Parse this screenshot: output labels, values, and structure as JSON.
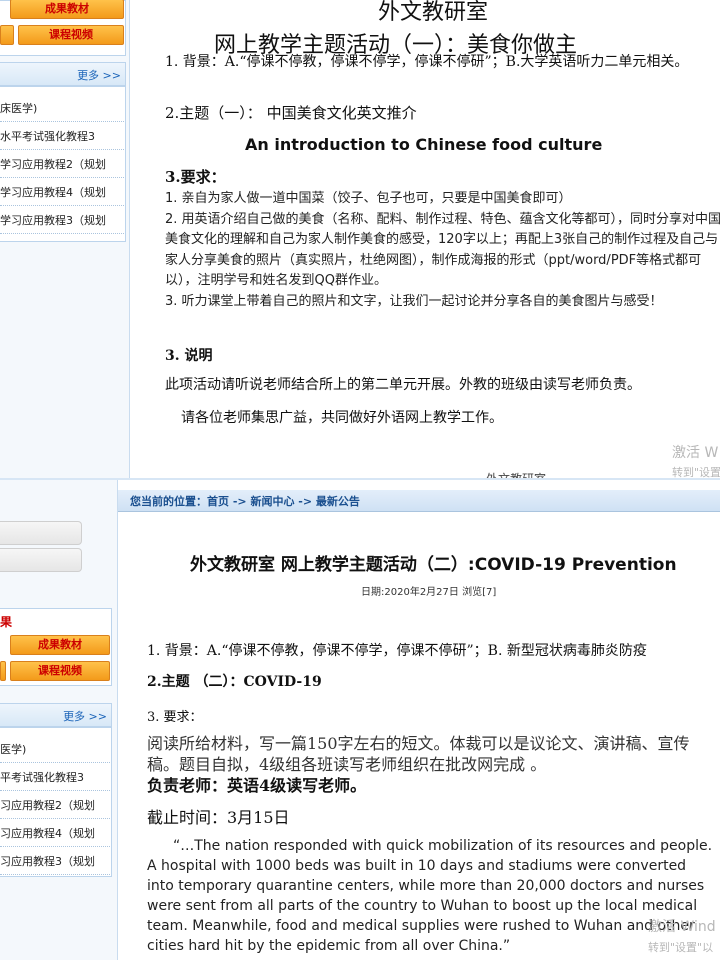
{
  "top": {
    "sidebar": {
      "buttons": [
        {
          "label": "成果教材"
        },
        {
          "label": "课程视频"
        }
      ],
      "more_label": "更多 >>",
      "items": [
        {
          "label": "床医学)"
        },
        {
          "label": "水平考试强化教程3"
        },
        {
          "label": "学习应用教程2（规划"
        },
        {
          "label": "学习应用教程4（规划"
        },
        {
          "label": "学习应用教程3（规划"
        }
      ]
    },
    "content": {
      "department": "外文教研室",
      "title": "网上教学主题活动（一）：美食你做主",
      "background": "1. 背景：A.“停课不停教，停课不停学，停课不停研”；B.大学英语听力二单元相关。",
      "theme": "2.主题（一）：  中国美食文化英文推介",
      "english_title": "An introduction to Chinese food culture",
      "requirements_heading": "3.要求：",
      "requirements": [
        "1. 亲自为家人做一道中国菜（饺子、包子也可，只要是中国美食即可）",
        "2. 用英语介绍自己做的美食（名称、配料、制作过程、特色、蕴含文化等都可），同时分享对中国美食文化的理解和自己为家人制作美食的感受，120字以上；再配上3张自己的制作过程及自己与家人分享美食的照片（真实照片，杜绝网图），制作成海报的形式（ppt/word/PDF等格式都可以），注明学号和姓名发到QQ群作业。",
        "3. 听力课堂上带着自己的照片和文字，让我们一起讨论并分享各自的美食图片与感受！"
      ],
      "note_heading": "3. 说明",
      "note_1": "此项活动请听说老师结合所上的第二单元开展。外教的班级由读写老师负责。",
      "note_2": "请各位老师集思广益，共同做好外语网上教学工作。",
      "watermark_1": "激活 W",
      "watermark_2": "转到\"设置",
      "signature": "外文教研室"
    }
  },
  "bottom": {
    "sidebar": {
      "section_label": "果",
      "buttons": [
        {
          "label": "成果教材"
        },
        {
          "label": "课程视频"
        }
      ],
      "more_label": "更多 >>",
      "items": [
        {
          "label": "医学)"
        },
        {
          "label": "平考试强化教程3"
        },
        {
          "label": "习应用教程2（规划"
        },
        {
          "label": "习应用教程4（规划"
        },
        {
          "label": "习应用教程3（规划"
        }
      ]
    },
    "breadcrumb": "您当前的位置：首页 -> 新闻中心 -> 最新公告",
    "content": {
      "title": "外文教研室 网上教学主题活动（二）:COVID-19 Prevention",
      "date_line": "日期:2020年2月27日 浏览[7]",
      "background": "1. 背景：A.“停课不停教，停课不停学，停课不停研”；B. 新型冠状病毒肺炎防疫",
      "theme": "2.主题 （二）：COVID-19",
      "requirements_heading": "3. 要求：",
      "requirements": "阅读所给材料，写一篇150字左右的短文。体裁可以是议论文、演讲稿、宣传稿。题目自拟，4级组各班读写老师组织在批改网完成    。",
      "teacher": "负责老师：英语4级读写老师。",
      "deadline": "截止时间：3月15日",
      "quote": "“…The nation responded with quick mobilization of its resources and people. A hospital with 1000 beds was built in 10 days and stadiums were converted into temporary quarantine centers, while more than 20,000 doctors and nurses were sent from all parts of the country to Wuhan to boost up the local medical team. Meanwhile, food and medical supplies were rushed to Wuhan and other cities hard hit by the epidemic from all over China.”",
      "watermark_1": "激活 Wind",
      "watermark_2": "转到\"设置\"以"
    }
  }
}
